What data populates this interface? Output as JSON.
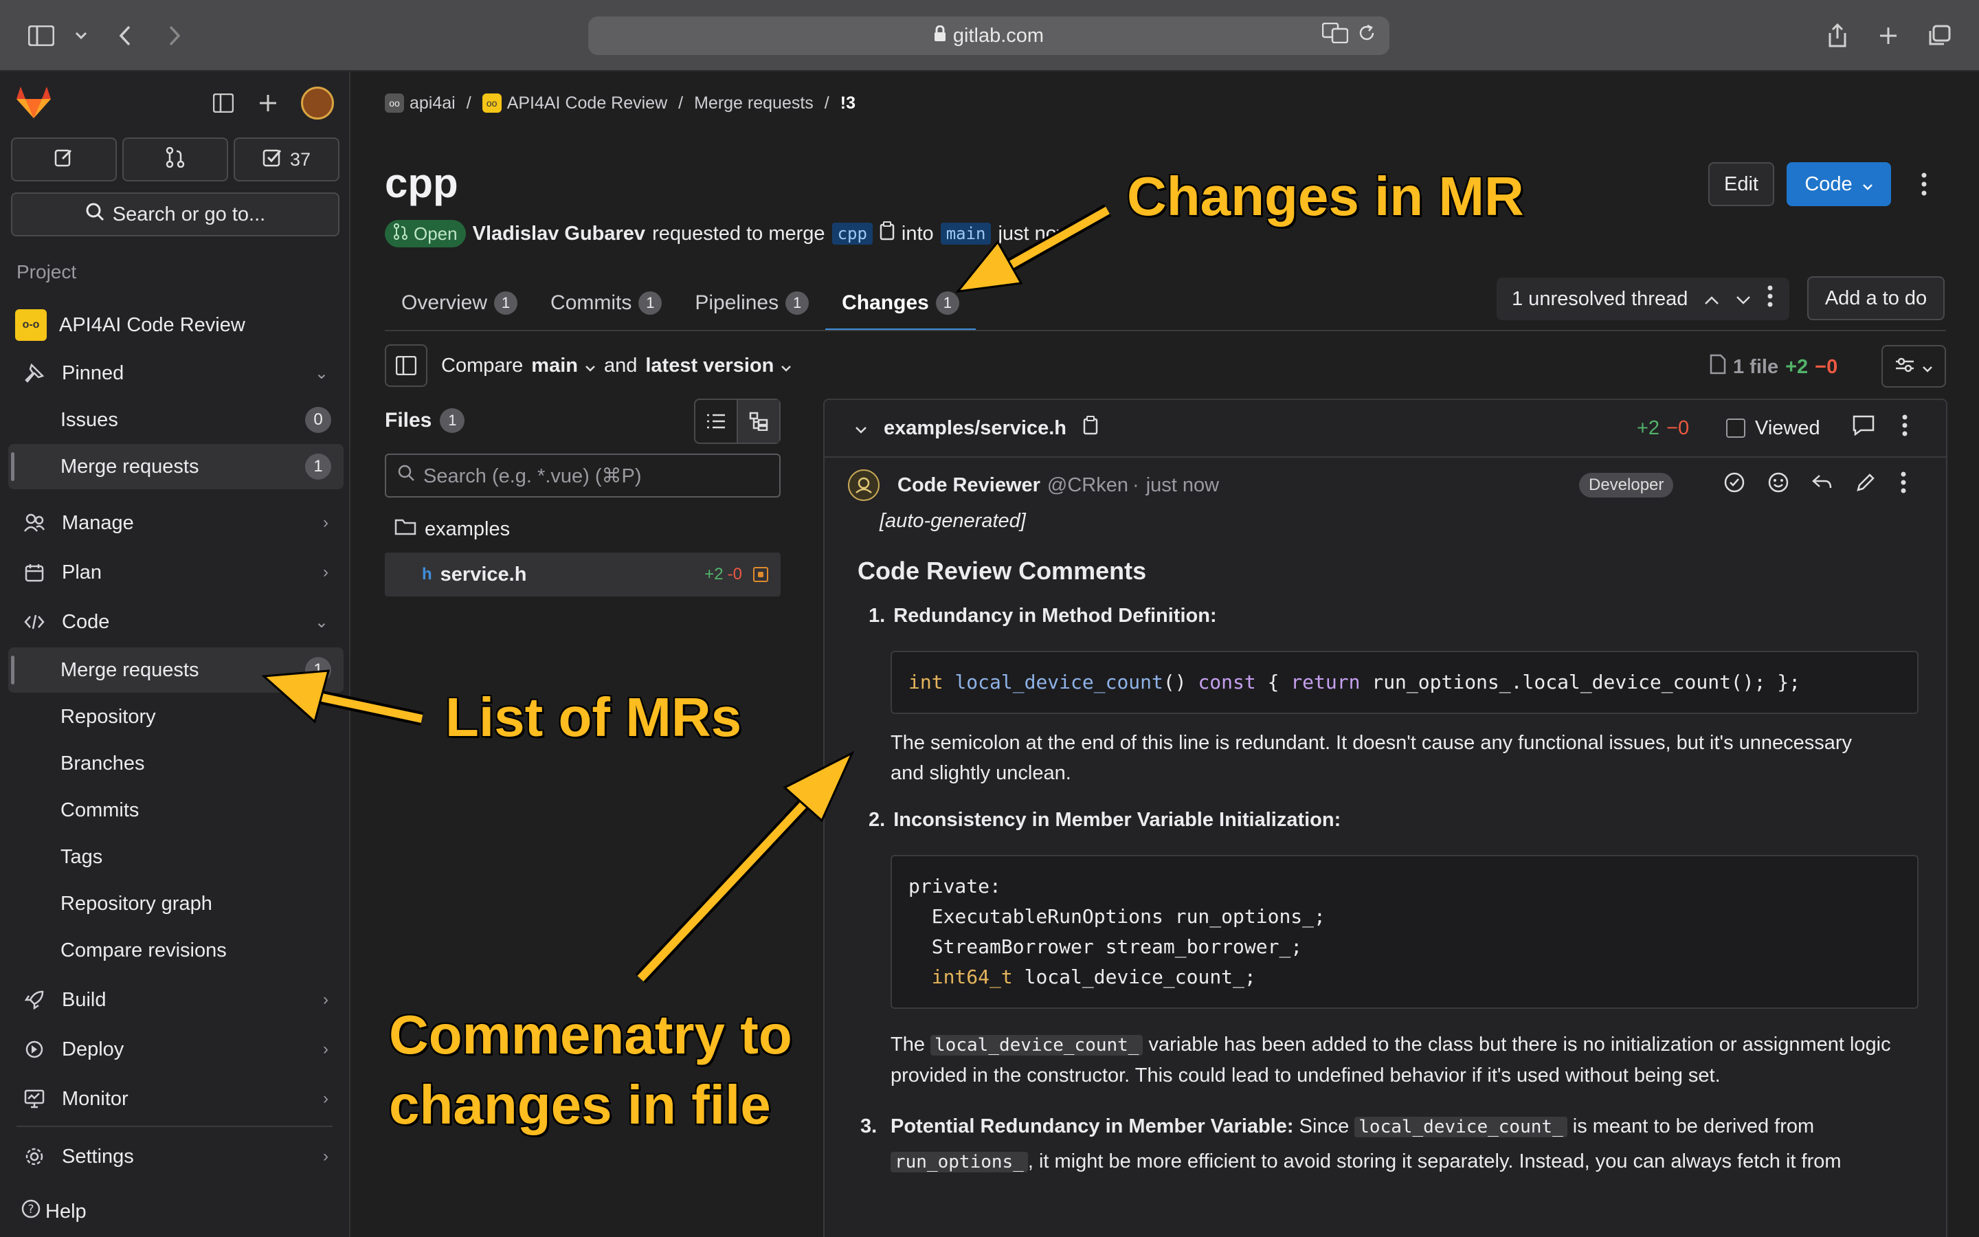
{
  "browser": {
    "url": "gitlab.com"
  },
  "sidebar": {
    "todo_count": "37",
    "search_label": "Search or go to...",
    "section_label": "Project",
    "project_name": "API4AI Code Review",
    "project_avatar": "o-o",
    "items": [
      {
        "label": "Pinned"
      },
      {
        "label": "Issues",
        "count": "0"
      },
      {
        "label": "Merge requests",
        "count": "1"
      },
      {
        "label": "Manage"
      },
      {
        "label": "Plan"
      },
      {
        "label": "Code"
      },
      {
        "label": "Merge requests",
        "count": "1"
      },
      {
        "label": "Repository"
      },
      {
        "label": "Branches"
      },
      {
        "label": "Commits"
      },
      {
        "label": "Tags"
      },
      {
        "label": "Repository graph"
      },
      {
        "label": "Compare revisions"
      },
      {
        "label": "Build"
      },
      {
        "label": "Deploy"
      },
      {
        "label": "Monitor"
      },
      {
        "label": "Settings"
      }
    ],
    "help_label": "Help"
  },
  "breadcrumb": {
    "items": [
      "api4ai",
      "API4AI Code Review",
      "Merge requests",
      "!3"
    ]
  },
  "mr": {
    "title": "cpp",
    "status": "Open",
    "author": "Vladislav Gubarev",
    "requested_text": "requested to merge",
    "source_branch": "cpp",
    "into_text": "into",
    "target_branch": "main",
    "time": "just now"
  },
  "header_buttons": {
    "edit": "Edit",
    "code": "Code"
  },
  "tabs": [
    {
      "label": "Overview",
      "count": "1"
    },
    {
      "label": "Commits",
      "count": "1"
    },
    {
      "label": "Pipelines",
      "count": "1"
    },
    {
      "label": "Changes",
      "count": "1"
    }
  ],
  "thread": {
    "label": "1 unresolved thread",
    "todo_button": "Add a to do"
  },
  "compare": {
    "compare_label": "Compare",
    "base": "main",
    "and_label": "and",
    "head": "latest version",
    "file_count": "1 file",
    "additions": "+2",
    "deletions": "−0"
  },
  "files": {
    "title": "Files",
    "count": "1",
    "search_placeholder": "Search (e.g. *.vue) (⌘P)",
    "folder": "examples",
    "file_name": "service.h",
    "file_add": "+2",
    "file_del": "-0"
  },
  "diff": {
    "path": "examples/service.h",
    "additions": "+2",
    "deletions": "−0",
    "viewed_label": "Viewed"
  },
  "note": {
    "author": "Code Reviewer",
    "handle": "@CRken",
    "separator": "·",
    "time": "just now",
    "role": "Developer",
    "auto": "[auto-generated]",
    "heading": "Code Review Comments",
    "items": [
      {
        "num": "1.",
        "title": "Redundancy in Method Definition:",
        "code_tokens": {
          "t1": "int",
          "t2": "local_device_count",
          "t3": "()",
          "t4": "const",
          "t5": "{",
          "t6": "return",
          "t7": "run_options_.local_device_count(); };"
        },
        "text": "The semicolon at the end of this line is redundant. It doesn't cause any functional issues, but it's unnecessary",
        "text2": "and slightly unclean."
      },
      {
        "num": "2.",
        "title": "Inconsistency in Member Variable Initialization:",
        "code_lines": [
          "private:",
          "  ExecutableRunOptions run_options_;",
          "  StreamBorrower stream_borrower_;"
        ],
        "code_type": "int64_t",
        "code_var": "local_device_count_;",
        "text_pre": "The",
        "text_code": "local_device_count_",
        "text_post": "variable has been added to the class but there is no initialization or assignment logic",
        "text2": "provided in the constructor. This could lead to undefined behavior if it's used without being set."
      },
      {
        "num": "3.",
        "title": "Potential Redundancy in Member Variable:",
        "text_pre": "Since",
        "text_code": "local_device_count_",
        "text_post": "is meant to be derived from",
        "text2_code": "run_options_",
        "text2": ", it might be more efficient to avoid storing it separately. Instead, you can always fetch it from"
      }
    ]
  },
  "annotations": {
    "changes": "Changes in MR",
    "list": "List of MRs",
    "comment1": "Commenatry to",
    "comment2": "changes in file"
  },
  "colors": {
    "accent": "#428fdc",
    "annotation": "#fdbc1f",
    "open_badge": "#24663b"
  }
}
